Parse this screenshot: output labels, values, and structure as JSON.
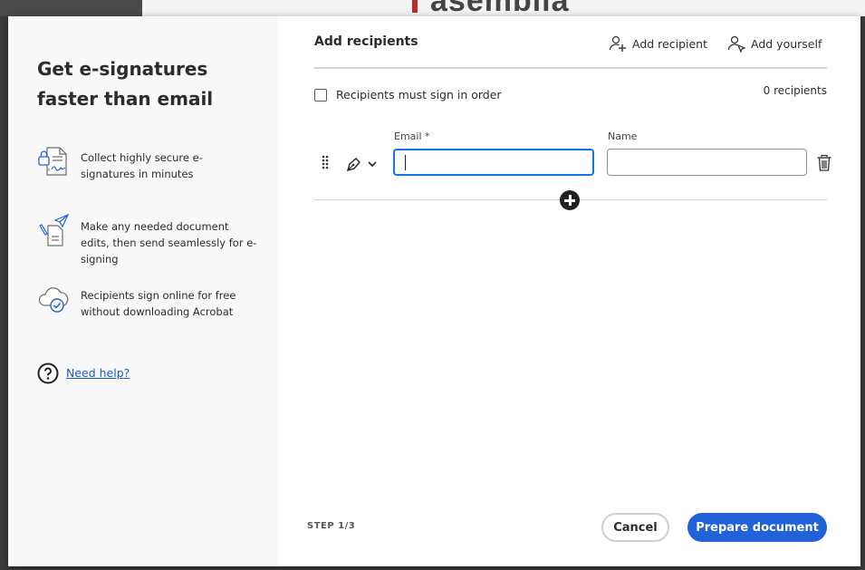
{
  "backdrop": {
    "doc_text": "asemblia"
  },
  "left": {
    "title": "Get e-signatures faster than email",
    "features": [
      {
        "icon": "secure-document-icon",
        "text": "Collect highly secure e-signatures in minutes"
      },
      {
        "icon": "edit-send-icon",
        "text": "Make any needed document edits, then send seamlessly for e-signing"
      },
      {
        "icon": "cloud-check-icon",
        "text": "Recipients sign online for free without downloading Acrobat"
      }
    ],
    "help_link": "Need help?"
  },
  "main": {
    "title": "Add recipients",
    "add_recipient": "Add recipient",
    "add_yourself": "Add yourself",
    "order_label": "Recipients must sign in order",
    "order_checked": false,
    "recipient_count": "0 recipients",
    "email_label": "Email *",
    "name_label": "Name",
    "email_value": "",
    "name_value": ""
  },
  "footer": {
    "step": "STEP 1/3",
    "cancel": "Cancel",
    "primary": "Prepare document"
  },
  "colors": {
    "primary": "#2162d9",
    "focus": "#1473e6",
    "link": "#1d5bbf"
  }
}
